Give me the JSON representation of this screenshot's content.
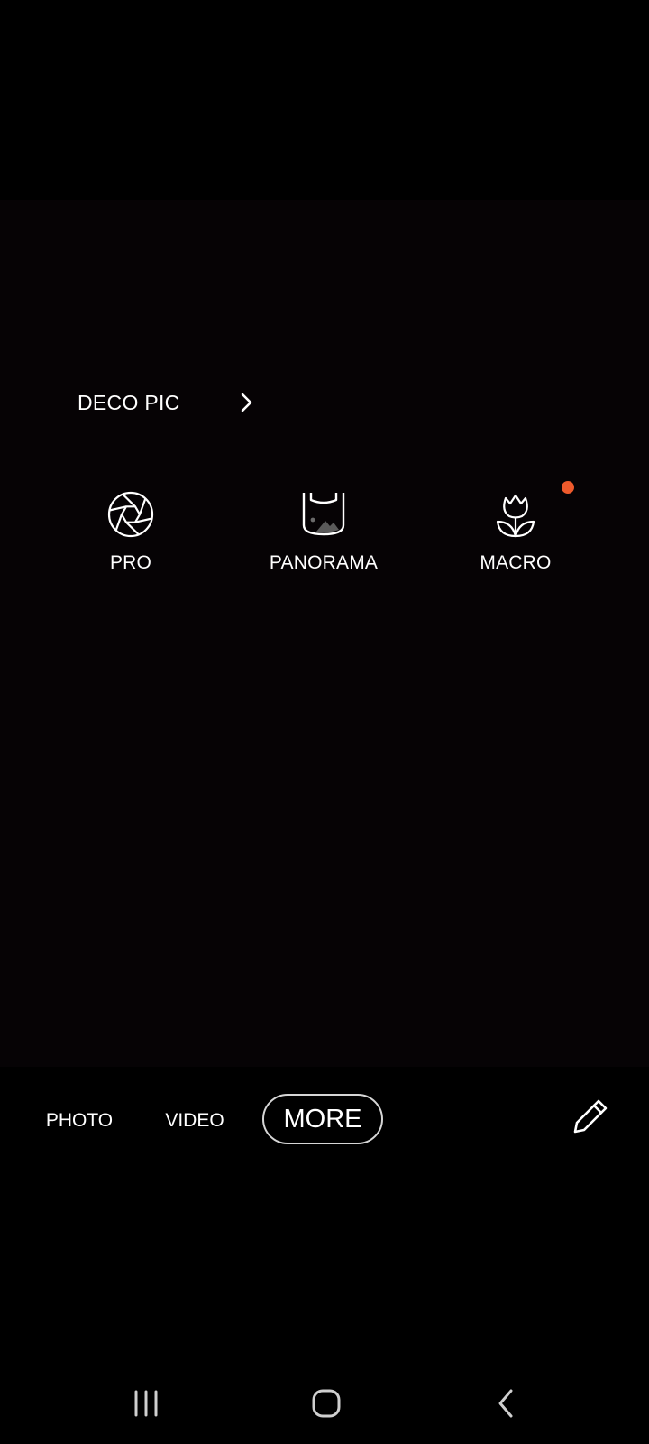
{
  "camera": {
    "deco_pic_label": "DECO PIC",
    "modes": [
      {
        "label": "PRO",
        "icon": "aperture-icon"
      },
      {
        "label": "PANORAMA",
        "icon": "panorama-icon"
      },
      {
        "label": "MACRO",
        "icon": "tulip-icon",
        "new_badge": true
      }
    ]
  },
  "mode_bar": {
    "photo": "PHOTO",
    "video": "VIDEO",
    "more": "MORE",
    "selected": "MORE",
    "edit_icon": "pencil-icon"
  },
  "nav": {
    "recents_icon": "recents-icon",
    "home_icon": "home-icon",
    "back_icon": "back-icon"
  },
  "colors": {
    "background": "#000000",
    "badge": "#ee5a2c",
    "text": "#ffffff"
  }
}
